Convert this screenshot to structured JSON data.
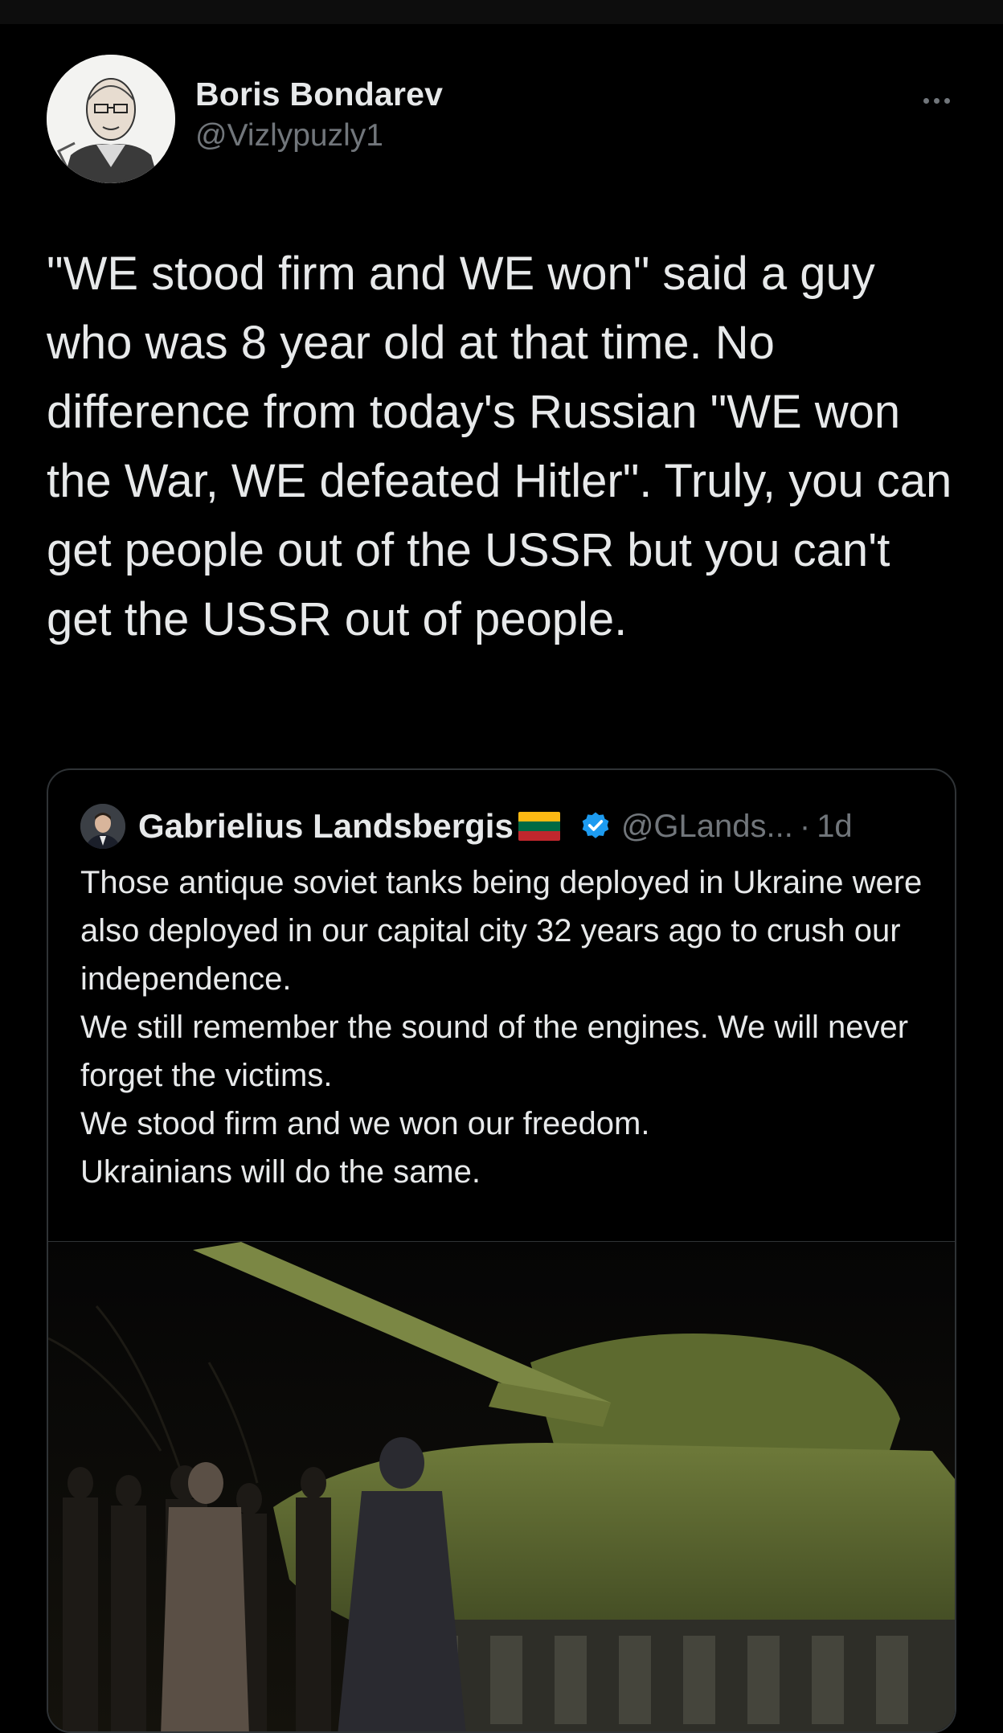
{
  "tweet": {
    "author_name": "Boris Bondarev",
    "author_handle": "@Vizlypuzly1",
    "text": "\"WE stood firm and WE won\" said a guy who was 8 year old at that time. No difference from today's Russian \"WE won the War, WE defeated Hitler\". Truly, you can get people out of the USSR but you can't get the USSR out of people.",
    "more_icon": "more-horizontal-icon"
  },
  "quote": {
    "author_name": "Gabrielius Landsbergis",
    "flag": "lithuania-flag-icon",
    "verified_icon": "verified-badge-icon",
    "handle": "@GLands...",
    "separator": "·",
    "time": "1d",
    "text": "Those antique soviet tanks being deployed in Ukraine were also deployed in our capital city 32 years ago to crush our independence.\nWe still remember the sound of the engines. We will never forget the victims.\nWe stood firm and we won our freedom.\nUkrainians will do the same."
  },
  "colors": {
    "background": "#000000",
    "text": "#e7e9ea",
    "secondary_text": "#71767b",
    "border": "#2f3336",
    "verified": "#1d9bf0"
  }
}
